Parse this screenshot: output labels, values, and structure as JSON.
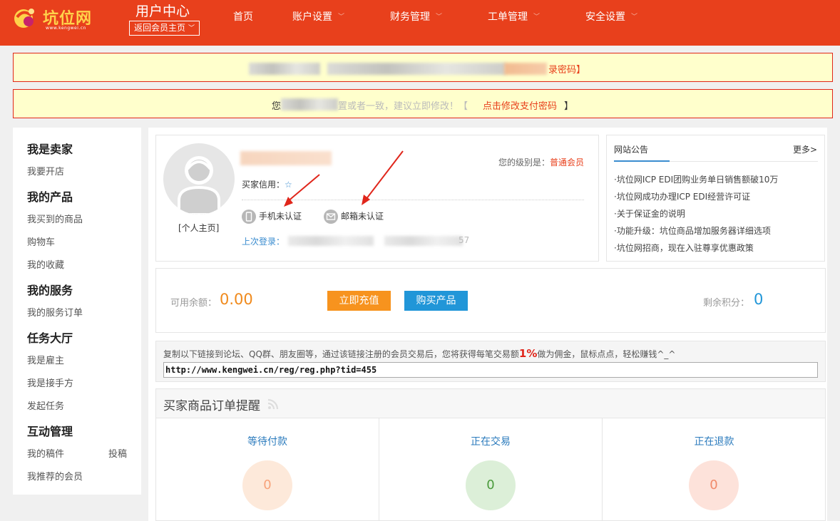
{
  "header": {
    "logo_text": "坑位网",
    "logo_url": "www.kengwei.cn",
    "title": "用户中心",
    "back_label": "返回会员主页",
    "nav": [
      {
        "label": "首页",
        "dropdown": false
      },
      {
        "label": "账户设置",
        "dropdown": true
      },
      {
        "label": "财务管理",
        "dropdown": true
      },
      {
        "label": "工单管理",
        "dropdown": true
      },
      {
        "label": "安全设置",
        "dropdown": true
      }
    ]
  },
  "notices": {
    "first_link_tail": "录密码】",
    "second_prefix": "您",
    "second_mid": "置或者一致，建议立即修改！【",
    "second_link": "点击修改支付密码",
    "second_suffix": "】"
  },
  "sidebar": {
    "groups": [
      {
        "heading": "我是卖家",
        "items": [
          "我要开店"
        ]
      },
      {
        "heading": "我的产品",
        "items": [
          "我买到的商品",
          "购物车",
          "我的收藏"
        ]
      },
      {
        "heading": "我的服务",
        "items": [
          "我的服务订单"
        ]
      },
      {
        "heading": "任务大厅",
        "items": [
          "我是雇主",
          "我是接手方",
          "发起任务"
        ]
      },
      {
        "heading": "互动管理",
        "items": [
          "我的稿件",
          "投稿",
          "我推荐的会员"
        ]
      }
    ]
  },
  "profile": {
    "home_link": "[个人主页]",
    "level_label": "您的级别是：",
    "level_value": "普通会员",
    "credit_label": "买家信用：",
    "credit_icon": "star-icon",
    "phone_status": "手机未认证",
    "email_status": "邮箱未认证",
    "last_login_label": "上次登录：",
    "last_login_tail": "57"
  },
  "announcements": {
    "title": "网站公告",
    "more": "更多>",
    "items": [
      "·坑位网ICP EDI团购业务单日销售额破10万",
      "·坑位网成功办理ICP EDI经营许可证",
      "·关于保证金的说明",
      "·功能升级：坑位商品增加服务器详细选项",
      "·坑位网招商，现在入驻尊享优惠政策"
    ]
  },
  "balance": {
    "available_label": "可用余额：",
    "available_value": "0.00",
    "recharge_button": "立即充值",
    "buy_button": "购买产品",
    "points_label": "剩余积分：",
    "points_value": "0"
  },
  "referral": {
    "text_before": "复制以下链接到论坛、QQ群、朋友圈等，通过该链接注册的会员交易后，您将获得每笔交易额",
    "percent": "1%",
    "text_after": "做为佣金，鼠标点点，轻松赚钱^_^",
    "link": "http://www.kengwei.cn/reg/reg.php?tid=455"
  },
  "orders": {
    "title": "买家商品订单提醒",
    "columns": [
      {
        "label": "等待付款",
        "count": "0",
        "bg": "#fde9da",
        "color": "#f7a27a"
      },
      {
        "label": "正在交易",
        "count": "0",
        "bg": "#dcefd8",
        "color": "#4a9a3c"
      },
      {
        "label": "正在退款",
        "count": "0",
        "bg": "#fde2da",
        "color": "#f08a6a"
      }
    ]
  },
  "colors": {
    "brand": "#e8401c",
    "link_blue": "#3a8ccf",
    "orange": "#f7931e",
    "blue": "#2196d8"
  }
}
